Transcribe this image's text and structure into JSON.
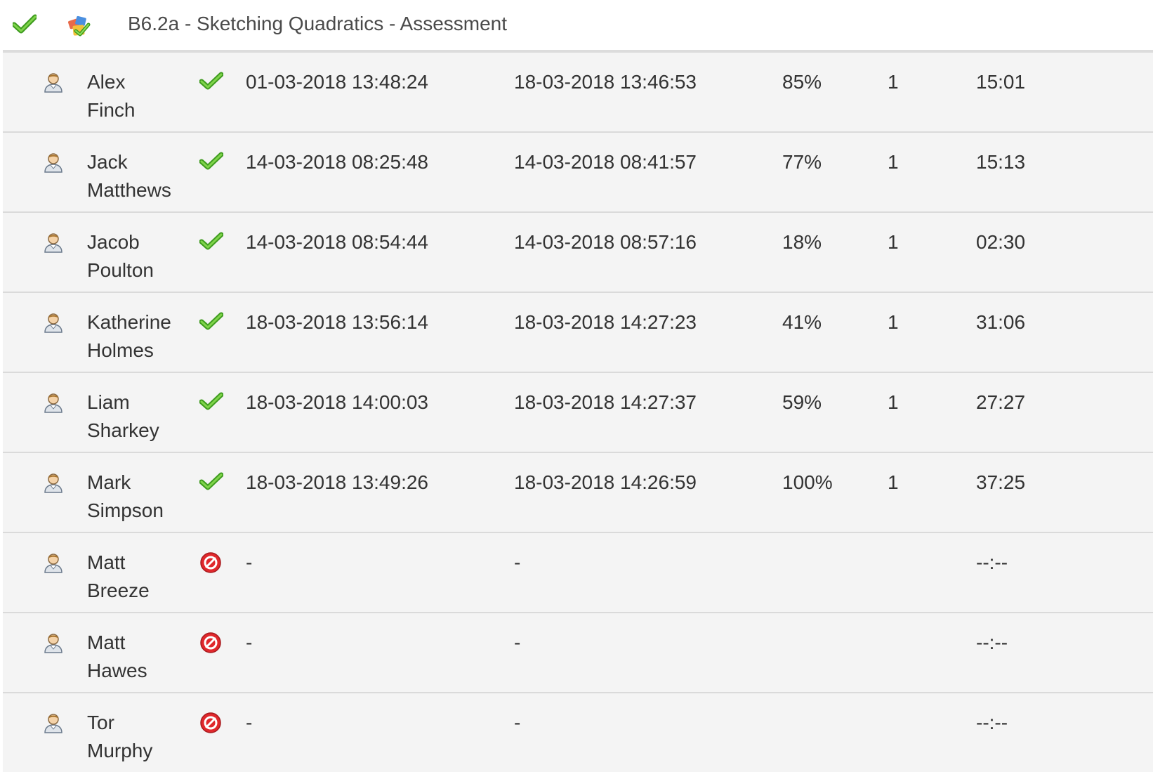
{
  "header": {
    "title": "B6.2a - Sketching Quadratics - Assessment",
    "icons": [
      "check-icon",
      "activity-icon"
    ]
  },
  "colors": {
    "complete": "#5cb82e",
    "not_started": "#e0282c",
    "row_background": "#f4f4f4",
    "divider": "#dadada"
  },
  "rows": [
    {
      "first": "Alex",
      "last": "Finch",
      "status": "complete",
      "started": "01-03-2018 13:48:24",
      "finished": "18-03-2018 13:46:53",
      "score": "85%",
      "attempts": "1",
      "duration": "15:01"
    },
    {
      "first": "Jack",
      "last": "Matthews",
      "status": "complete",
      "started": "14-03-2018 08:25:48",
      "finished": "14-03-2018 08:41:57",
      "score": "77%",
      "attempts": "1",
      "duration": "15:13"
    },
    {
      "first": "Jacob",
      "last": "Poulton",
      "status": "complete",
      "started": "14-03-2018 08:54:44",
      "finished": "14-03-2018 08:57:16",
      "score": "18%",
      "attempts": "1",
      "duration": "02:30"
    },
    {
      "first": "Katherine",
      "last": "Holmes",
      "status": "complete",
      "started": "18-03-2018 13:56:14",
      "finished": "18-03-2018 14:27:23",
      "score": "41%",
      "attempts": "1",
      "duration": "31:06"
    },
    {
      "first": "Liam",
      "last": "Sharkey",
      "status": "complete",
      "started": "18-03-2018 14:00:03",
      "finished": "18-03-2018 14:27:37",
      "score": "59%",
      "attempts": "1",
      "duration": "27:27"
    },
    {
      "first": "Mark",
      "last": "Simpson",
      "status": "complete",
      "started": "18-03-2018 13:49:26",
      "finished": "18-03-2018 14:26:59",
      "score": "100%",
      "attempts": "1",
      "duration": "37:25"
    },
    {
      "first": "Matt",
      "last": "Breeze",
      "status": "not-started",
      "started": "-",
      "finished": "-",
      "score": "",
      "attempts": "",
      "duration": "--:--"
    },
    {
      "first": "Matt",
      "last": "Hawes",
      "status": "not-started",
      "started": "-",
      "finished": "-",
      "score": "",
      "attempts": "",
      "duration": "--:--"
    },
    {
      "first": "Tor",
      "last": "Murphy",
      "status": "not-started",
      "started": "-",
      "finished": "-",
      "score": "",
      "attempts": "",
      "duration": "--:--"
    }
  ]
}
